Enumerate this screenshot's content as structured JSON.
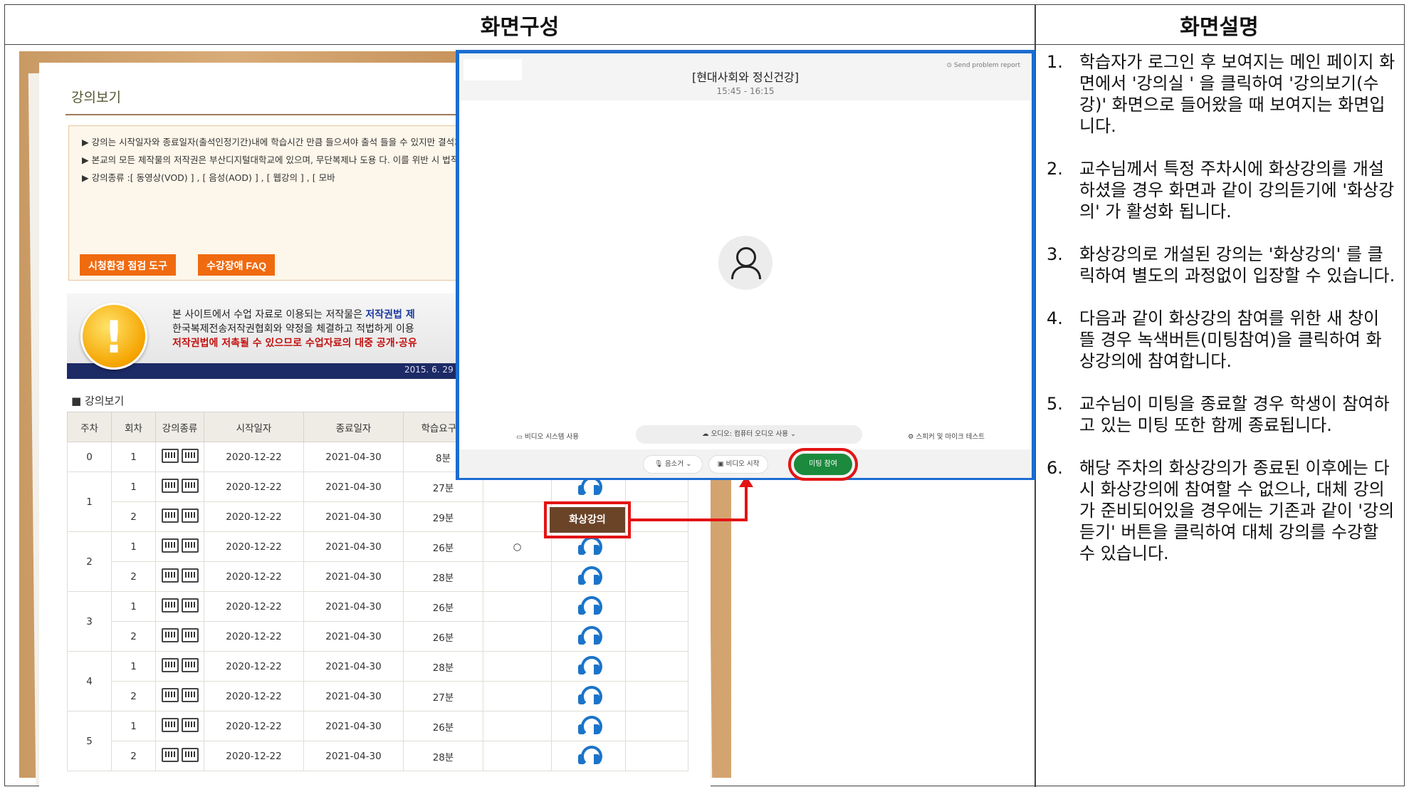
{
  "header": {
    "left": "화면구성",
    "right": "화면설명"
  },
  "page": {
    "title": "강의보기",
    "notices": [
      "▶ 강의는 시작일자와 종료일자(출석인정기간)내에 학습시간 만큼 들으셔야 출석 들을 수 있지만 결석처리 됩니다.",
      "▶ 본교의 모든 제작물의 저작권은 부산디지털대학교에 있으며, 무단복제나 도용 다. 이를 위반 시 법적인 처벌을 받을 수 있습니다.",
      "▶ 강의종류 :[ 동영상(VOD) ] , [ 음성(AOD) ] , [ 웹강의 ] , [ 모바"
    ],
    "buttons": {
      "env_check": "시청환경 점검 도구",
      "faq": "수강장애 FAQ"
    },
    "banner": {
      "line1_prefix": "본 사이트에서 수업 자료로 이용되는 저작물은 ",
      "line1_bold": "저작권법 제",
      "line2": "한국복제전송저작권협회와 약정을 체결하고 적법하게 이용",
      "line3": "저작권법에 저촉될 수 있으므로 수업자료의 대중 공개·공유",
      "date": "2015. 6. 29"
    },
    "section_label": "■ 강의보기",
    "table": {
      "headers": [
        "주차",
        "회차",
        "강의종류",
        "시작일자",
        "종료일자",
        "학습요구시"
      ],
      "rows": [
        {
          "week": "0",
          "session": "1",
          "start": "2020-12-22",
          "end": "2021-04-30",
          "time": "8분",
          "mark": ""
        },
        {
          "week": "1",
          "session": "1",
          "start": "2020-12-22",
          "end": "2021-04-30",
          "time": "27분",
          "mark": ""
        },
        {
          "week": "",
          "session": "2",
          "start": "2020-12-22",
          "end": "2021-04-30",
          "time": "29분",
          "mark": ""
        },
        {
          "week": "2",
          "session": "1",
          "start": "2020-12-22",
          "end": "2021-04-30",
          "time": "26분",
          "mark": "○"
        },
        {
          "week": "",
          "session": "2",
          "start": "2020-12-22",
          "end": "2021-04-30",
          "time": "28분",
          "mark": ""
        },
        {
          "week": "3",
          "session": "1",
          "start": "2020-12-22",
          "end": "2021-04-30",
          "time": "26분",
          "mark": ""
        },
        {
          "week": "",
          "session": "2",
          "start": "2020-12-22",
          "end": "2021-04-30",
          "time": "26분",
          "mark": ""
        },
        {
          "week": "4",
          "session": "1",
          "start": "2020-12-22",
          "end": "2021-04-30",
          "time": "28분",
          "mark": ""
        },
        {
          "week": "",
          "session": "2",
          "start": "2020-12-22",
          "end": "2021-04-30",
          "time": "27분",
          "mark": ""
        },
        {
          "week": "5",
          "session": "1",
          "start": "2020-12-22",
          "end": "2021-04-30",
          "time": "26분",
          "mark": ""
        },
        {
          "week": "",
          "session": "2",
          "start": "2020-12-22",
          "end": "2021-04-30",
          "time": "28분",
          "mark": ""
        }
      ],
      "video_lecture_label": "화상강의"
    }
  },
  "meeting": {
    "title": "[현대사회와 정신건강]",
    "time": "15:45 - 16:15",
    "report": "Send problem report",
    "video_system": "비디오 시스템 사용",
    "audio": "오디오: 컴퓨터 오디오 사용",
    "speaker_test": "스피커 및 마이크 테스트",
    "mute": "음소거",
    "start_video": "비디오 시작",
    "join": "미팅 참여"
  },
  "description": [
    {
      "num": "1.",
      "text": "학습자가 로그인 후 보여지는 메인 페이지 화면에서 '강의실 ' 을 클릭하여 '강의보기(수강)' 화면으로 들어왔을 때 보여지는 화면입니다."
    },
    {
      "num": "2.",
      "text": "교수님께서 특정 주차시에 화상강의를 개설하셨을 경우 화면과 같이 강의듣기에 '화상강의' 가 활성화 됩니다."
    },
    {
      "num": "3.",
      "text": "화상강의로 개설된 강의는 '화상강의' 를 클릭하여 별도의 과정없이 입장할 수 있습니다."
    },
    {
      "num": "4.",
      "text": "다음과 같이 화상강의 참여를 위한 새 창이 뜰 경우 녹색버튼(미팅참여)을 클릭하여 화상강의에 참여합니다."
    },
    {
      "num": "5.",
      "text": "교수님이 미팅을 종료할 경우 학생이 참여하고 있는 미팅 또한 함께 종료됩니다."
    },
    {
      "num": "6.",
      "text": "해당 주차의 화상강의가 종료된 이후에는 다시 화상강의에 참여할 수 없으나, 대체 강의가 준비되어있을 경우에는 기존과 같이 '강의듣기' 버튼을 클릭하여 대체 강의를 수강할 수 있습니다."
    }
  ]
}
